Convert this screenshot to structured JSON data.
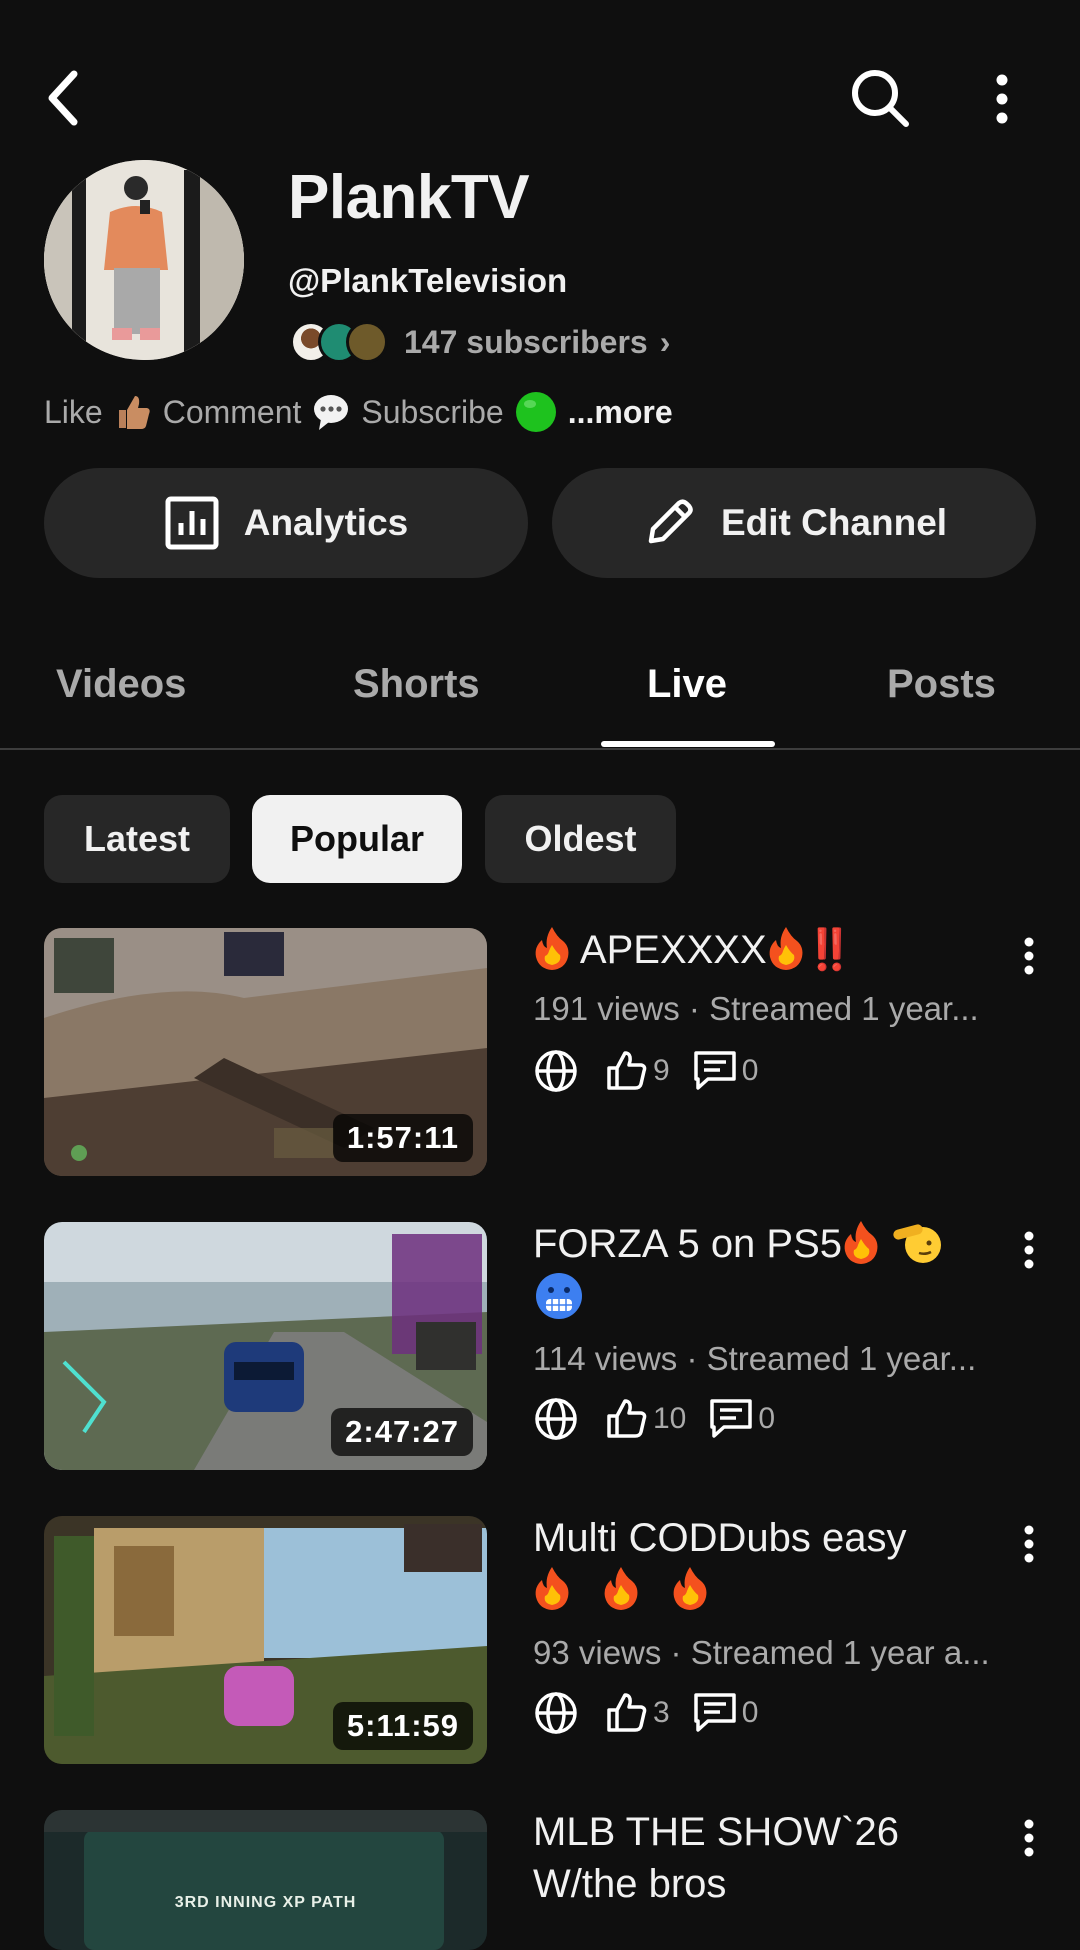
{
  "channel": {
    "name": "PlankTV",
    "handle": "@PlankTelevision",
    "subscribers": "147 subscribers",
    "subscribers_chevron": "›",
    "description": {
      "like": "Like",
      "comment": "Comment",
      "subscribe": "Subscribe",
      "more": "...more"
    }
  },
  "actions": {
    "analytics": "Analytics",
    "edit_channel": "Edit Channel"
  },
  "tabs": [
    {
      "label": "Videos",
      "active": false
    },
    {
      "label": "Shorts",
      "active": false
    },
    {
      "label": "Live",
      "active": true
    },
    {
      "label": "Posts",
      "active": false
    }
  ],
  "filters": [
    {
      "label": "Latest",
      "selected": false
    },
    {
      "label": "Popular",
      "selected": true
    },
    {
      "label": "Oldest",
      "selected": false
    }
  ],
  "videos": [
    {
      "title": "APEXXXX",
      "suffix": "‼️",
      "meta": "191 views · Streamed 1 year...",
      "duration": "1:57:11",
      "likes": "9",
      "comments": "0"
    },
    {
      "title": "FORZA 5 on PS5",
      "meta": "114 views · Streamed 1 year...",
      "duration": "2:47:27",
      "likes": "10",
      "comments": "0"
    },
    {
      "title": "Multi CODDubs easy",
      "meta": "93 views · Streamed 1 year a...",
      "duration": "5:11:59",
      "likes": "3",
      "comments": "0"
    },
    {
      "title": "MLB THE SHOW`26 W/the bros",
      "thumb_text": "3RD INNING XP PATH"
    }
  ],
  "icons": {
    "back": "back-arrow-icon",
    "search": "search-icon",
    "overflow": "more-vertical-icon",
    "visibility": "globe-icon",
    "likes": "thumbs-up-icon",
    "comments": "comment-icon"
  },
  "colors": {
    "background": "#0f0f0f",
    "surface": "#272727",
    "text_primary": "#f1f1f1",
    "text_secondary": "#aaaaaa",
    "chip_selected": "#f1f1f1"
  }
}
